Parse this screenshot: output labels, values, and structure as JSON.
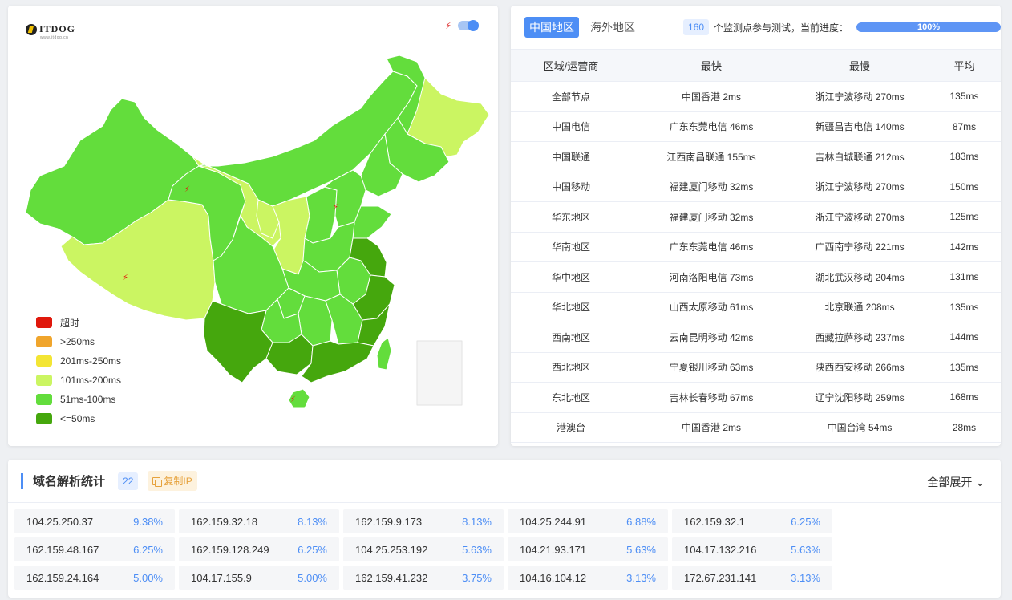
{
  "logo": {
    "text": "ITDOG",
    "subtext": "www.itdog.cn"
  },
  "colors": {
    "timeout": "#e0180c",
    "over250": "#f0a52c",
    "r201_250": "#f3e534",
    "r101_200": "#cbf562",
    "r51_100": "#63dd3c",
    "le50": "#45a70d",
    "accent": "#4d8ef5"
  },
  "legend": [
    {
      "label": "超时",
      "color": "#e0180c"
    },
    {
      "label": ">250ms",
      "color": "#f0a52c"
    },
    {
      "label": "201ms-250ms",
      "color": "#f3e534"
    },
    {
      "label": "101ms-200ms",
      "color": "#cbf562"
    },
    {
      "label": "51ms-100ms",
      "color": "#63dd3c"
    },
    {
      "label": "<=50ms",
      "color": "#45a70d"
    }
  ],
  "tabs": [
    {
      "label": "中国地区",
      "active": true
    },
    {
      "label": "海外地区",
      "active": false
    }
  ],
  "monitor": {
    "count": "160",
    "text": "个监测点参与测试，当前进度：",
    "progress_label": "100%",
    "progress": 1.0
  },
  "table": {
    "headers": [
      "区域/运营商",
      "最快",
      "最慢",
      "平均"
    ],
    "rows": [
      [
        "全部节点",
        "中国香港 2ms",
        "浙江宁波移动 270ms",
        "135ms"
      ],
      [
        "中国电信",
        "广东东莞电信 46ms",
        "新疆昌吉电信 140ms",
        "87ms"
      ],
      [
        "中国联通",
        "江西南昌联通 155ms",
        "吉林白城联通 212ms",
        "183ms"
      ],
      [
        "中国移动",
        "福建厦门移动 32ms",
        "浙江宁波移动 270ms",
        "150ms"
      ],
      [
        "华东地区",
        "福建厦门移动 32ms",
        "浙江宁波移动 270ms",
        "125ms"
      ],
      [
        "华南地区",
        "广东东莞电信 46ms",
        "广西南宁移动 221ms",
        "142ms"
      ],
      [
        "华中地区",
        "河南洛阳电信 73ms",
        "湖北武汉移动 204ms",
        "131ms"
      ],
      [
        "华北地区",
        "山西太原移动 61ms",
        "北京联通 208ms",
        "135ms"
      ],
      [
        "西南地区",
        "云南昆明移动 42ms",
        "西藏拉萨移动 237ms",
        "144ms"
      ],
      [
        "西北地区",
        "宁夏银川移动 63ms",
        "陕西西安移动 266ms",
        "135ms"
      ],
      [
        "东北地区",
        "吉林长春移动 67ms",
        "辽宁沈阳移动 259ms",
        "168ms"
      ],
      [
        "港澳台",
        "中国香港 2ms",
        "中国台湾 54ms",
        "28ms"
      ]
    ]
  },
  "dns": {
    "title": "域名解析统计",
    "count": "22",
    "copy_label": "复制IP",
    "expand_label": "全部展开",
    "items": [
      {
        "ip": "104.25.250.37",
        "pct": "9.38%"
      },
      {
        "ip": "162.159.32.18",
        "pct": "8.13%"
      },
      {
        "ip": "162.159.9.173",
        "pct": "8.13%"
      },
      {
        "ip": "104.25.244.91",
        "pct": "6.88%"
      },
      {
        "ip": "162.159.32.1",
        "pct": "6.25%"
      },
      {
        "ip": "162.159.48.167",
        "pct": "6.25%"
      },
      {
        "ip": "162.159.128.249",
        "pct": "6.25%"
      },
      {
        "ip": "104.25.253.192",
        "pct": "5.63%"
      },
      {
        "ip": "104.21.93.171",
        "pct": "5.63%"
      },
      {
        "ip": "104.17.132.216",
        "pct": "5.63%"
      },
      {
        "ip": "162.159.24.164",
        "pct": "5.00%"
      },
      {
        "ip": "104.17.155.9",
        "pct": "5.00%"
      },
      {
        "ip": "162.159.41.232",
        "pct": "3.75%"
      },
      {
        "ip": "104.16.104.12",
        "pct": "3.13%"
      },
      {
        "ip": "172.67.231.141",
        "pct": "3.13%"
      }
    ]
  }
}
